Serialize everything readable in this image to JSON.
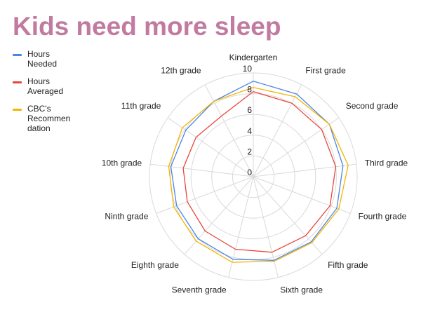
{
  "chart_data": {
    "type": "radar",
    "title": "Kids need more sleep",
    "categories": [
      "Kindergarten",
      "First grade",
      "Second grade",
      "Third grade",
      "Fourth grade",
      "Fifth grade",
      "Sixth grade",
      "Seventh grade",
      "Eighth grade",
      "Ninth grade",
      "10th grade",
      "11th grade",
      "12th grade"
    ],
    "rlim": [
      0,
      10
    ],
    "ticks": [
      "0",
      "2",
      "4",
      "6",
      "8",
      "10"
    ],
    "grid": true,
    "legend_position": "left",
    "series": [
      {
        "name": "Hours Needed",
        "color": "#4a86e8",
        "values": [
          9.2,
          9.0,
          8.9,
          8.7,
          8.6,
          8.4,
          8.3,
          8.2,
          8.0,
          7.9,
          8.0,
          7.9,
          8.2
        ]
      },
      {
        "name": "Hours Averaged",
        "color": "#e8453c",
        "values": [
          8.2,
          8.0,
          8.0,
          8.0,
          7.9,
          7.6,
          7.5,
          7.2,
          7.0,
          6.8,
          6.8,
          6.7,
          6.6
        ]
      },
      {
        "name": "CBC's Recommendation",
        "color": "#f4b400",
        "values": [
          8.6,
          8.7,
          8.9,
          9.2,
          8.8,
          8.5,
          8.4,
          8.5,
          8.3,
          8.2,
          8.2,
          8.3,
          8.2
        ]
      }
    ]
  }
}
